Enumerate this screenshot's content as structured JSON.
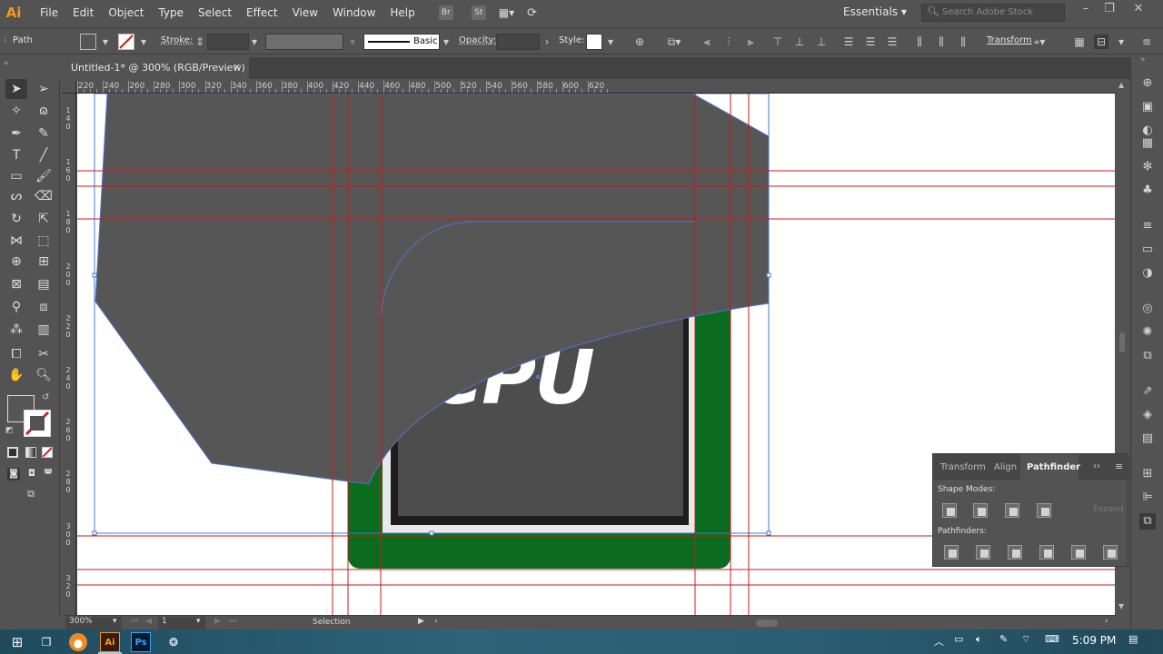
{
  "app": {
    "logo": "Ai",
    "menu": [
      "File",
      "Edit",
      "Object",
      "Type",
      "Select",
      "Effect",
      "View",
      "Window",
      "Help"
    ],
    "bridge_label": "Br",
    "stock_label": "St",
    "workspace": "Essentials",
    "search_placeholder": "Search Adobe Stock"
  },
  "control_bar": {
    "selection_type": "Path",
    "stroke_label": "Stroke:",
    "stroke_value": "",
    "brush_label": "Basic",
    "opacity_label": "Opacity:",
    "opacity_value": "",
    "style_label": "Style:",
    "transform_label": "Transform"
  },
  "document": {
    "tab_title": "Untitled-1* @ 300% (RGB/Preview)",
    "close_glyph": "×",
    "zoom": "300%",
    "artboard_number": "1",
    "status_tool": "Selection"
  },
  "rulers": {
    "top": [
      "220",
      "240",
      "260",
      "280",
      "300",
      "320",
      "340",
      "360",
      "380",
      "400",
      "420",
      "440",
      "460",
      "480",
      "500",
      "520",
      "540",
      "560",
      "580",
      "600",
      "620"
    ],
    "left": [
      "1\n4\n0",
      "1\n6\n0",
      "1\n8\n0",
      "2\n0\n0",
      "2\n2\n0",
      "2\n4\n0",
      "2\n6\n0",
      "2\n8\n0",
      "3\n0\n0",
      "3\n2\n0"
    ]
  },
  "artwork": {
    "logo_text": "CPU",
    "colors": {
      "dark_shape": "#575656",
      "board_green": "#0b6c1f",
      "chip_frame_light": "#e9e9e9",
      "chip_frame_dark": "#1d1d1d",
      "chip_face": "#4d4d4e",
      "guide": "#c91b1b",
      "path_outline": "#4d74d1"
    }
  },
  "pathfinder_panel": {
    "tabs": [
      "Transform",
      "Align",
      "Pathfinder"
    ],
    "active_tab": "Pathfinder",
    "shape_modes_label": "Shape Modes:",
    "pathfinders_label": "Pathfinders:",
    "expand_label": "Expand",
    "shape_mode_buttons": [
      "unite",
      "minus-front",
      "intersect",
      "exclude"
    ],
    "pathfinder_buttons": [
      "divide",
      "trim",
      "merge",
      "crop",
      "outline",
      "minus-back"
    ]
  },
  "taskbar": {
    "time": "5:09 PM",
    "apps": [
      "windows-start",
      "task-view",
      "firefox",
      "illustrator",
      "photoshop",
      "app-swirl"
    ],
    "ai_label": "Ai",
    "ps_label": "Ps"
  }
}
